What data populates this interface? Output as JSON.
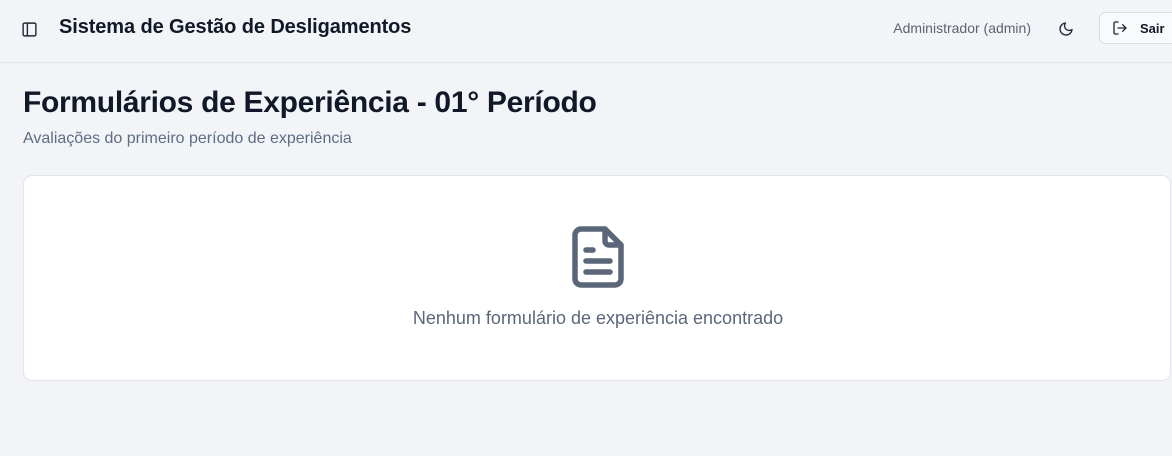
{
  "header": {
    "title": "Sistema de Gestão de Desligamentos",
    "user": "Administrador (admin)",
    "logout_label": "Sair",
    "icons": {
      "sidebar_toggle": "panel-left-icon",
      "theme_toggle": "moon-icon",
      "logout": "log-out-icon"
    }
  },
  "main": {
    "title": "Formulários de Experiência - 01° Período",
    "subtitle": "Avaliações do primeiro período de experiência",
    "empty_state": {
      "icon": "file-text-icon",
      "message": "Nenhum formulário de experiência encontrado"
    }
  },
  "colors": {
    "background": "#f3f4f7",
    "card": "#ffffff",
    "text_primary": "#111827",
    "text_muted": "#5e6c84",
    "icon_muted": "#5b6779"
  }
}
